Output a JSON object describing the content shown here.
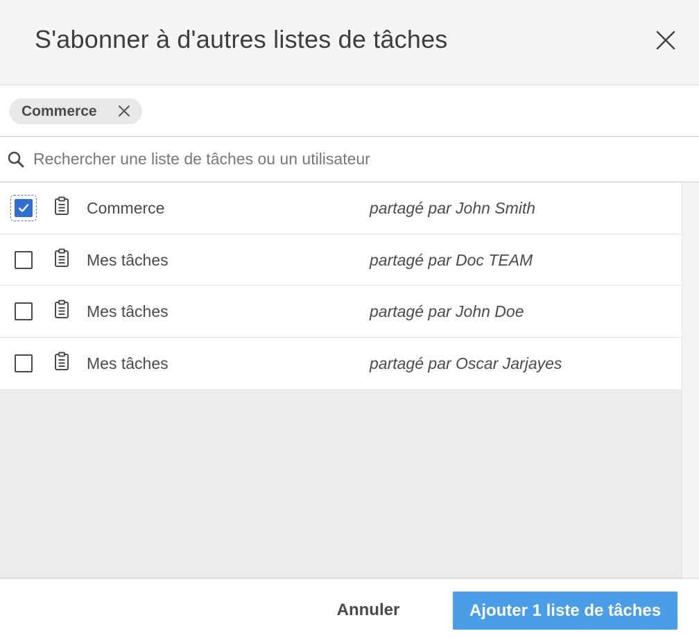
{
  "dialog": {
    "title": "S'abonner à d'autres listes de tâches"
  },
  "filter": {
    "chips": [
      {
        "label": "Commerce"
      }
    ]
  },
  "search": {
    "placeholder": "Rechercher une liste de tâches ou un utilisateur",
    "value": ""
  },
  "lists": [
    {
      "name": "Commerce",
      "shared_by": "partagé par John Smith",
      "checked": true
    },
    {
      "name": "Mes tâches",
      "shared_by": "partagé par Doc TEAM",
      "checked": false
    },
    {
      "name": "Mes tâches",
      "shared_by": "partagé par John Doe",
      "checked": false
    },
    {
      "name": "Mes tâches",
      "shared_by": "partagé par Oscar Jarjayes",
      "checked": false
    }
  ],
  "footer": {
    "cancel_label": "Annuler",
    "add_label": "Ajouter 1 liste de tâches"
  },
  "icons": {
    "close": "close-icon",
    "chip_remove": "close-icon",
    "search": "search-icon",
    "list": "clipboard-icon",
    "check": "check-icon"
  },
  "colors": {
    "primary_button": "#4a9ee8",
    "checkbox_checked": "#2f6fd1",
    "header_bg": "#f5f5f5",
    "list_area_bg": "#ececec",
    "text": "#4a4a4a"
  }
}
